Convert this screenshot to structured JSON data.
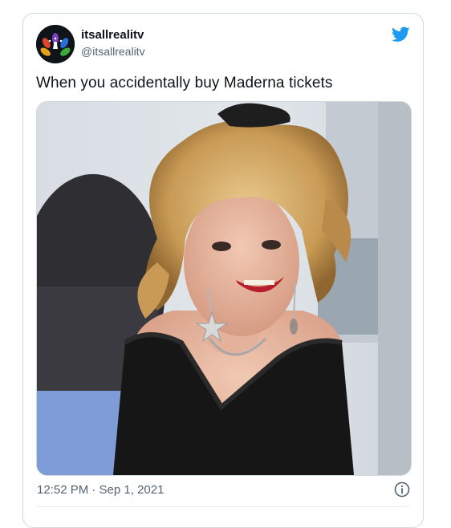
{
  "tweet": {
    "display_name": "itsallrealitv",
    "handle": "@itsallrealitv",
    "text": "When you accidentally buy Maderna tickets",
    "timestamp": "12:52 PM · Sep 1, 2021"
  },
  "icons": {
    "brand": "twitter-bird-icon",
    "info": "info-icon",
    "avatar": "peacock-logo-avatar"
  },
  "colors": {
    "brand_blue": "#1d9bf0",
    "text_primary": "#0f1419",
    "text_secondary": "#536471",
    "border": "#cfd9de"
  }
}
